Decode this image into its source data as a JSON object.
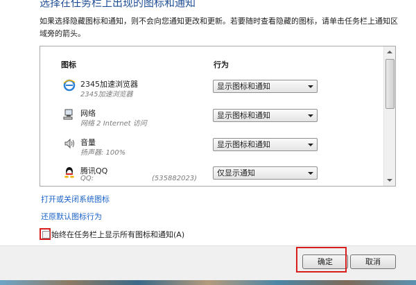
{
  "dialog": {
    "title": "选择在任务栏上出现的图标和通知",
    "description": "如果选择隐藏图标和通知，则不会向您通知更改和更新。若要随时查看隐藏的图标，请单击任务栏上通知区域旁的箭头。"
  },
  "table": {
    "col_icon": "图标",
    "col_behavior": "行为",
    "rows": [
      {
        "icon": "ie-browser-icon",
        "name": "2345加速浏览器",
        "sub": "2345加速浏览器",
        "sub2": "",
        "behavior": "显示图标和通知"
      },
      {
        "icon": "network-icon",
        "name": "网络",
        "sub": "网络 2 Internet 访问",
        "sub2": "",
        "behavior": "显示图标和通知"
      },
      {
        "icon": "volume-icon",
        "name": "音量",
        "sub": "扬声器: 100%",
        "sub2": "",
        "behavior": "显示图标和通知"
      },
      {
        "icon": "qq-penguin-icon",
        "name": "腾讯QQ",
        "sub": "QQ:",
        "sub2": "(535882023)",
        "behavior": "仅显示通知"
      }
    ]
  },
  "links": {
    "system_icons": "打开或关闭系统图标",
    "restore_default": "还原默认图标行为"
  },
  "checkbox": {
    "label": "始终在任务栏上显示所有图标和通知(A)",
    "checked": false
  },
  "buttons": {
    "ok": "确定",
    "cancel": "取消"
  },
  "colors": {
    "title": "#1f4e96",
    "link": "#1a63c9",
    "highlight": "#d81d1d"
  }
}
